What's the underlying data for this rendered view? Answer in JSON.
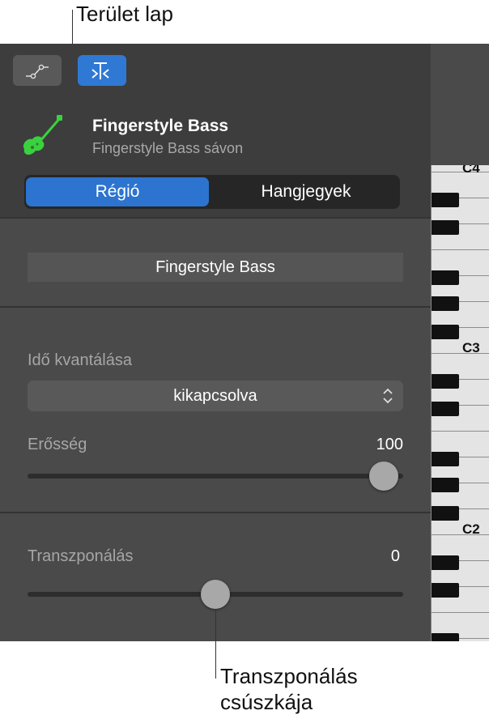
{
  "callouts": {
    "region_tab": "Terület lap",
    "transpose_slider_line1": "Transzponálás",
    "transpose_slider_line2": "csúszkája"
  },
  "header": {
    "track_name": "Fingerstyle Bass",
    "track_subtitle": "Fingerstyle Bass sávon",
    "tabs": [
      {
        "label": "Régió",
        "selected": true
      },
      {
        "label": "Hangjegyek",
        "selected": false
      }
    ]
  },
  "region": {
    "name": "Fingerstyle Bass"
  },
  "time_quantize": {
    "label": "Idő kvantálása",
    "value": "kikapcsolva"
  },
  "velocity": {
    "label": "Erősség",
    "value": "100",
    "fraction": 1.0
  },
  "transpose": {
    "label": "Transzponálás",
    "value": "0",
    "fraction": 0.5
  },
  "keyboard": {
    "labels": [
      "C4",
      "C3",
      "C2"
    ]
  },
  "colors": {
    "accent": "#2c74cf",
    "instrument": "#3ad13f",
    "panel": "#4a4a4a"
  }
}
